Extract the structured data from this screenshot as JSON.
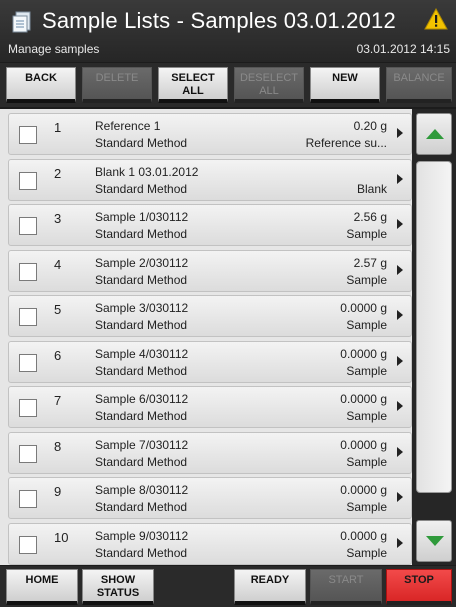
{
  "header": {
    "title": "Sample Lists - Samples 03.01.2012",
    "subtitle": "Manage samples",
    "datetime": "03.01.2012 14:15",
    "app_icon": "sample-list-icon",
    "warning_icon": "warning-triangle-icon",
    "warning_color": "#f2c200"
  },
  "toolbar": {
    "back": "BACK",
    "delete": "DELETE",
    "select_all": "SELECT\nALL",
    "deselect_all": "DESELECT\nALL",
    "new": "NEW",
    "balance": "BALANCE"
  },
  "samples": [
    {
      "num": "1",
      "name": "Reference 1",
      "method": "Standard Method",
      "amount": "0.20 g",
      "type": "Reference su...",
      "checked": false
    },
    {
      "num": "2",
      "name": "Blank 1 03.01.2012",
      "method": "Standard Method",
      "amount": "",
      "type": "Blank",
      "checked": false
    },
    {
      "num": "3",
      "name": "Sample 1/030112",
      "method": "Standard Method",
      "amount": "2.56 g",
      "type": "Sample",
      "checked": false
    },
    {
      "num": "4",
      "name": "Sample 2/030112",
      "method": "Standard Method",
      "amount": "2.57 g",
      "type": "Sample",
      "checked": false
    },
    {
      "num": "5",
      "name": "Sample 3/030112",
      "method": "Standard Method",
      "amount": "0.0000 g",
      "type": "Sample",
      "checked": false
    },
    {
      "num": "6",
      "name": "Sample 4/030112",
      "method": "Standard Method",
      "amount": "0.0000 g",
      "type": "Sample",
      "checked": false
    },
    {
      "num": "7",
      "name": "Sample 6/030112",
      "method": "Standard Method",
      "amount": "0.0000 g",
      "type": "Sample",
      "checked": false
    },
    {
      "num": "8",
      "name": "Sample 7/030112",
      "method": "Standard Method",
      "amount": "0.0000 g",
      "type": "Sample",
      "checked": false
    },
    {
      "num": "9",
      "name": "Sample 8/030112",
      "method": "Standard Method",
      "amount": "0.0000 g",
      "type": "Sample",
      "checked": false
    },
    {
      "num": "10",
      "name": "Sample 9/030112",
      "method": "Standard Method",
      "amount": "0.0000 g",
      "type": "Sample",
      "checked": false
    }
  ],
  "scrollbar": {
    "up_icon": "arrow-up-icon",
    "down_icon": "arrow-down-icon",
    "arrow_color": "#2f9a3b"
  },
  "bottombar": {
    "home": "HOME",
    "show_status": "SHOW\nSTATUS",
    "ready": "READY",
    "start": "START",
    "stop": "STOP",
    "stop_color": "#e53030"
  }
}
